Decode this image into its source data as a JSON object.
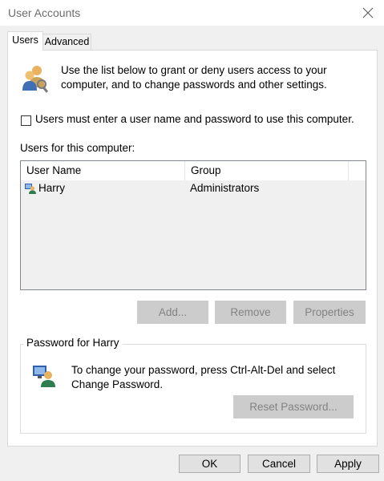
{
  "window": {
    "title": "User Accounts"
  },
  "tabs": [
    {
      "label": "Users",
      "active": true
    },
    {
      "label": "Advanced",
      "active": false
    }
  ],
  "intro": {
    "text": "Use the list below to grant or deny users access to your computer, and to change passwords and other settings."
  },
  "require_login": {
    "label": "Users must enter a user name and password to use this computer.",
    "checked": false
  },
  "users_section": {
    "label": "Users for this computer:",
    "columns": [
      "User Name",
      "Group"
    ],
    "rows": [
      {
        "name": "Harry",
        "group": "Administrators"
      }
    ]
  },
  "user_buttons": {
    "add": "Add...",
    "remove": "Remove",
    "properties": "Properties"
  },
  "password_group": {
    "title": "Password for Harry",
    "text": "To change your password, press Ctrl-Alt-Del and select Change Password.",
    "reset_button": "Reset Password..."
  },
  "dialog_buttons": {
    "ok": "OK",
    "cancel": "Cancel",
    "apply": "Apply"
  },
  "colors": {
    "window_bg": "#f0f0f0",
    "panel_bg": "#ffffff",
    "disabled_button_bg": "#cccccc",
    "disabled_text": "#838383"
  },
  "icons": {
    "intro": "users-icon",
    "row": "user-icon",
    "password": "computer-user-icon",
    "close": "close-icon"
  }
}
